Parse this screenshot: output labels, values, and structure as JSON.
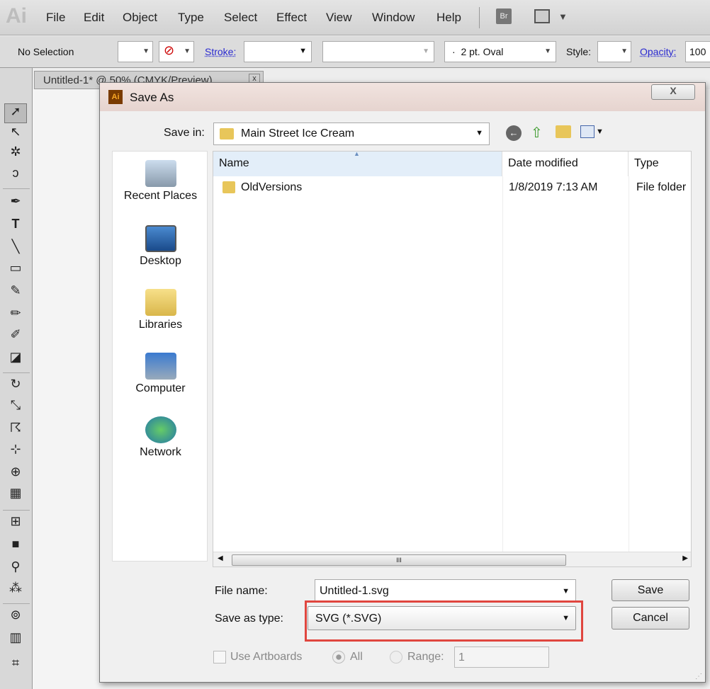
{
  "app": {
    "logo": "Ai",
    "menu": [
      "File",
      "Edit",
      "Object",
      "Type",
      "Select",
      "Effect",
      "View",
      "Window",
      "Help"
    ],
    "bridge": "Br"
  },
  "control_bar": {
    "selection": "No Selection",
    "stroke_label": "Stroke:",
    "brush": "2 pt. Oval",
    "brush_bullet": "·",
    "style_label": "Style:",
    "opacity_label": "Opacity:",
    "opacity_value": "100"
  },
  "document_tab": {
    "title": "Untitled-1* @ 50% (CMYK/Preview)",
    "close": "x"
  },
  "dialog": {
    "title": "Save As",
    "close": "X",
    "save_in_label": "Save in:",
    "save_in_value": "Main Street Ice Cream",
    "places": [
      "Recent Places",
      "Desktop",
      "Libraries",
      "Computer",
      "Network"
    ],
    "columns": [
      "Name",
      "Date modified",
      "Type"
    ],
    "rows": [
      {
        "name": "OldVersions",
        "date": "1/8/2019 7:13 AM",
        "type": "File folder"
      }
    ],
    "scroll_grip": "III",
    "file_name_label": "File name:",
    "file_name_value": "Untitled-1.svg",
    "save_type_label": "Save as type:",
    "save_type_value": "SVG (*.SVG)",
    "save_button": "Save",
    "cancel_button": "Cancel",
    "use_artboards": "Use Artboards",
    "all": "All",
    "range_label": "Range:",
    "range_value": "1",
    "highlight_color": "#e0463f"
  }
}
